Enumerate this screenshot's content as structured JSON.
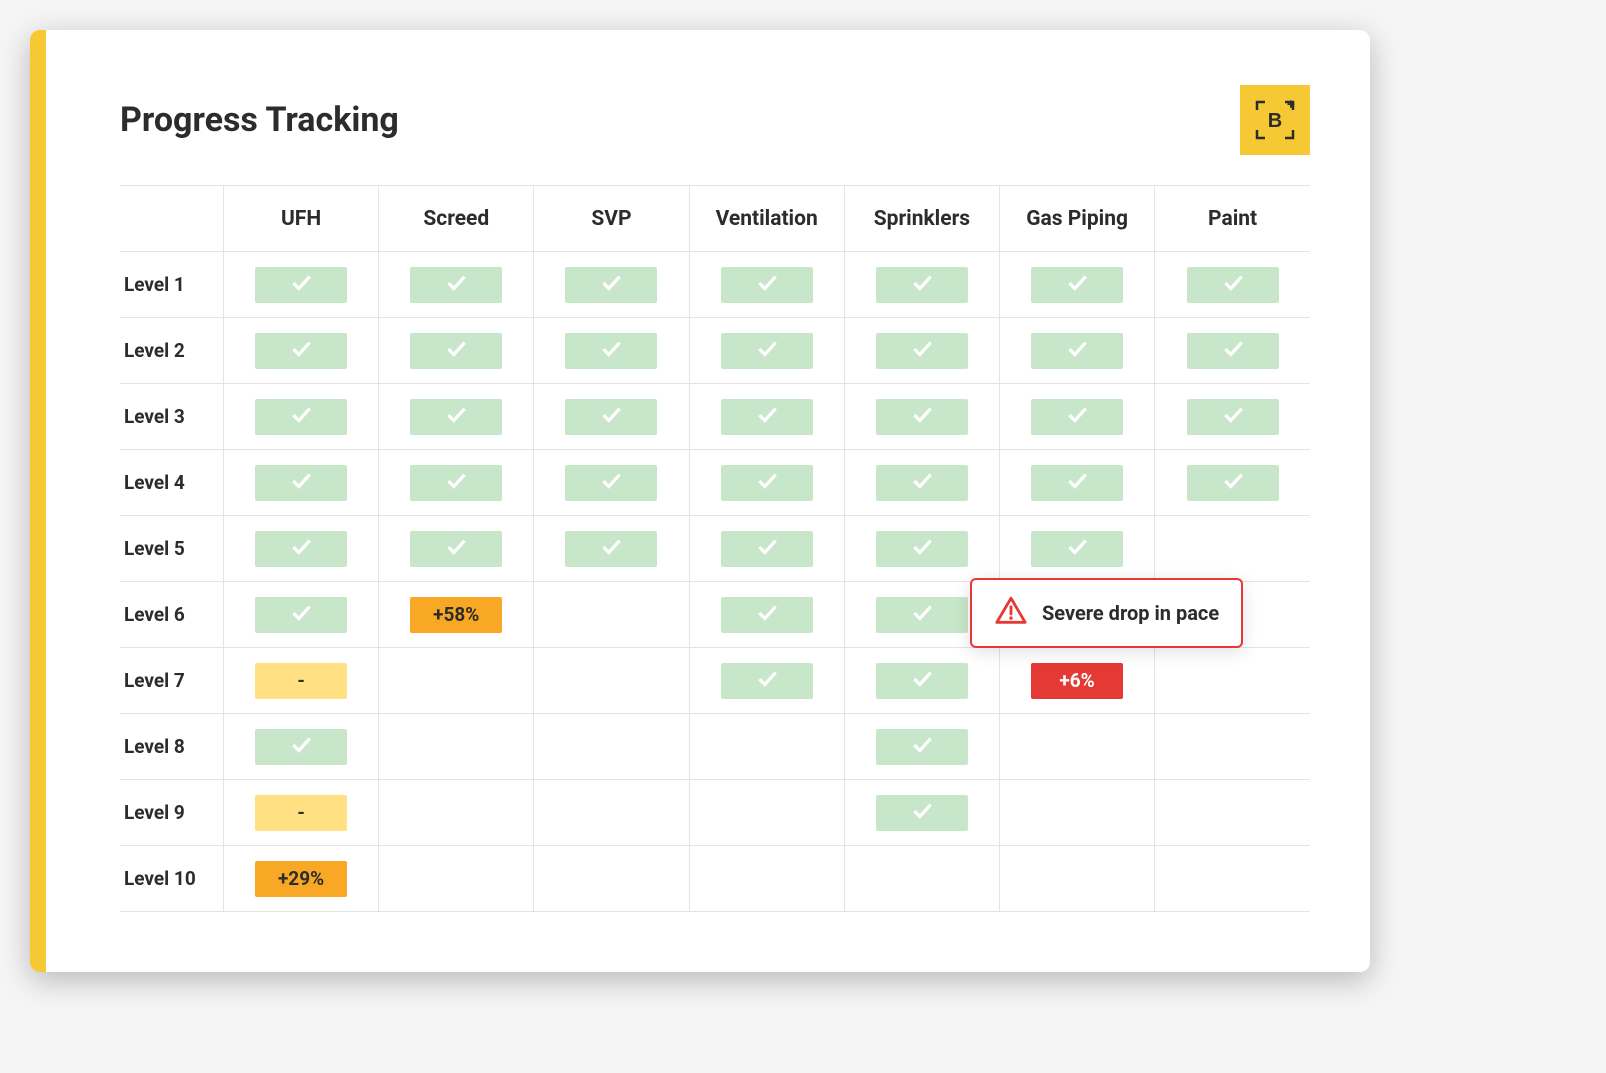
{
  "title": "Progress Tracking",
  "columns": [
    "UFH",
    "Screed",
    "SVP",
    "Ventilation",
    "Sprinklers",
    "Gas Piping",
    "Paint"
  ],
  "rows": [
    {
      "label": "Level 1",
      "cells": [
        {
          "type": "done"
        },
        {
          "type": "done"
        },
        {
          "type": "done"
        },
        {
          "type": "done"
        },
        {
          "type": "done"
        },
        {
          "type": "done"
        },
        {
          "type": "done"
        }
      ]
    },
    {
      "label": "Level 2",
      "cells": [
        {
          "type": "done"
        },
        {
          "type": "done"
        },
        {
          "type": "done"
        },
        {
          "type": "done"
        },
        {
          "type": "done"
        },
        {
          "type": "done"
        },
        {
          "type": "done"
        }
      ]
    },
    {
      "label": "Level 3",
      "cells": [
        {
          "type": "done"
        },
        {
          "type": "done"
        },
        {
          "type": "done"
        },
        {
          "type": "done"
        },
        {
          "type": "done"
        },
        {
          "type": "done"
        },
        {
          "type": "done"
        }
      ]
    },
    {
      "label": "Level 4",
      "cells": [
        {
          "type": "done"
        },
        {
          "type": "done"
        },
        {
          "type": "done"
        },
        {
          "type": "done"
        },
        {
          "type": "done"
        },
        {
          "type": "done"
        },
        {
          "type": "done"
        }
      ]
    },
    {
      "label": "Level 5",
      "cells": [
        {
          "type": "done"
        },
        {
          "type": "done"
        },
        {
          "type": "done"
        },
        {
          "type": "done"
        },
        {
          "type": "done"
        },
        {
          "type": "done"
        },
        {
          "type": "empty"
        }
      ]
    },
    {
      "label": "Level 6",
      "cells": [
        {
          "type": "done"
        },
        {
          "type": "highpct",
          "value": "+58%"
        },
        {
          "type": "empty"
        },
        {
          "type": "done"
        },
        {
          "type": "done"
        },
        {
          "type": "empty"
        },
        {
          "type": "empty"
        }
      ]
    },
    {
      "label": "Level 7",
      "cells": [
        {
          "type": "pending",
          "value": "-"
        },
        {
          "type": "empty"
        },
        {
          "type": "empty"
        },
        {
          "type": "done"
        },
        {
          "type": "done"
        },
        {
          "type": "alert",
          "value": "+6%"
        },
        {
          "type": "empty"
        }
      ]
    },
    {
      "label": "Level 8",
      "cells": [
        {
          "type": "done"
        },
        {
          "type": "empty"
        },
        {
          "type": "empty"
        },
        {
          "type": "empty"
        },
        {
          "type": "done"
        },
        {
          "type": "empty"
        },
        {
          "type": "empty"
        }
      ]
    },
    {
      "label": "Level 9",
      "cells": [
        {
          "type": "pending",
          "value": "-"
        },
        {
          "type": "empty"
        },
        {
          "type": "empty"
        },
        {
          "type": "empty"
        },
        {
          "type": "done"
        },
        {
          "type": "empty"
        },
        {
          "type": "empty"
        }
      ]
    },
    {
      "label": "Level 10",
      "cells": [
        {
          "type": "highpct",
          "value": "+29%"
        },
        {
          "type": "empty"
        },
        {
          "type": "empty"
        },
        {
          "type": "empty"
        },
        {
          "type": "empty"
        },
        {
          "type": "empty"
        },
        {
          "type": "empty"
        }
      ]
    }
  ],
  "callout": {
    "message": "Severe drop in pace",
    "target": {
      "row": 6,
      "col": 5
    }
  },
  "logo_letter": "B"
}
